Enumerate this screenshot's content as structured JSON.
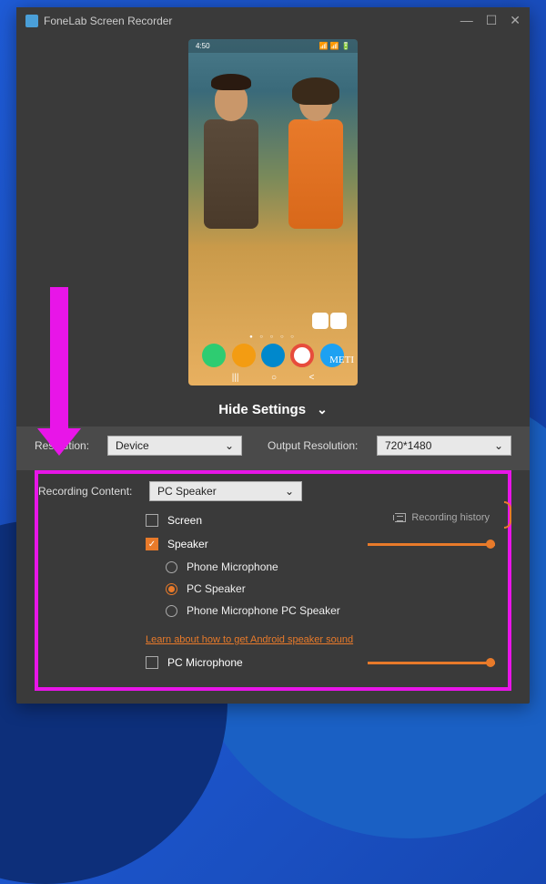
{
  "titlebar": {
    "app_name": "FoneLab Screen Recorder"
  },
  "phone": {
    "time": "4:50",
    "status_icons": "▼ ◎ ⬤ ⚙",
    "signal": "📶 📶 🔋",
    "watermark": "METI",
    "nav": {
      "recent": "|||",
      "home": "○",
      "back": "<"
    }
  },
  "main": {
    "hide_settings": "Hide Settings"
  },
  "settings": {
    "resolution_label": "Resolution:",
    "resolution_value": "Device",
    "output_label": "Output Resolution:",
    "output_value": "720*1480"
  },
  "recording": {
    "label": "Recording Content:",
    "dropdown_value": "PC Speaker",
    "screen": "Screen",
    "speaker": "Speaker",
    "phone_mic": "Phone Microphone",
    "pc_speaker": "PC Speaker",
    "phone_mic_pc_speaker": "Phone Microphone  PC Speaker",
    "learn_link": "Learn about how to get Android speaker sound",
    "pc_microphone": "PC Microphone",
    "history": "Recording history"
  }
}
